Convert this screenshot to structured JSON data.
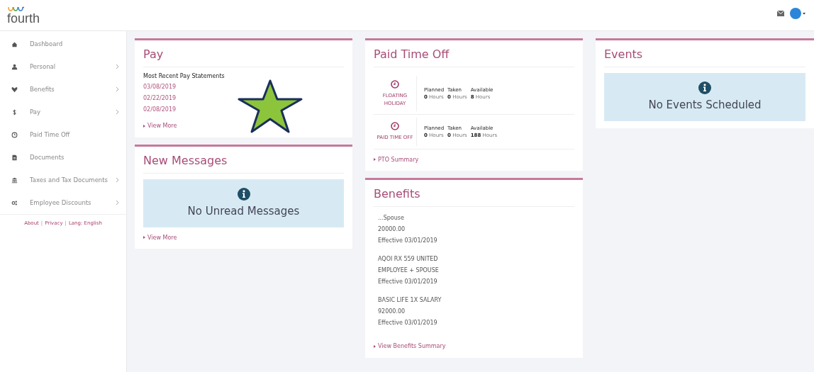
{
  "header": {
    "logo": "fourth"
  },
  "sidebar": {
    "items": [
      {
        "kind": "home",
        "label": "Dashboard",
        "submenu": false
      },
      {
        "kind": "person",
        "label": "Personal",
        "submenu": true
      },
      {
        "kind": "heart",
        "label": "Benefits",
        "submenu": true
      },
      {
        "kind": "dollar",
        "label": "Pay",
        "submenu": true
      },
      {
        "kind": "clock",
        "label": "Paid Time Off",
        "submenu": false
      },
      {
        "kind": "document",
        "label": "Documents",
        "submenu": false
      },
      {
        "kind": "bank",
        "label": "Taxes and Tax Documents",
        "submenu": true
      },
      {
        "kind": "gears",
        "label": "Employee Discounts",
        "submenu": true
      }
    ],
    "footer_links": [
      "About",
      "Privacy",
      "Lang: English"
    ],
    "separator": "|"
  },
  "pay": {
    "title": "Pay",
    "subtitle": "Most Recent Pay Statements",
    "statements": [
      "03/08/2019",
      "02/22/2019",
      "02/08/2019"
    ],
    "link": "View More"
  },
  "messages": {
    "title": "New Messages",
    "notice": "No Unread Messages",
    "link": "View More"
  },
  "paid_time_off": {
    "title": "Paid Time Off",
    "rows": [
      {
        "name": "FLOATING HOLIDAY",
        "columns": [
          {
            "header": "Planned",
            "amount": "0",
            "unit": "Hours"
          },
          {
            "header": "Taken",
            "amount": "0",
            "unit": "Hours"
          },
          {
            "header": "Available",
            "amount": "8",
            "unit": "Hours"
          }
        ]
      },
      {
        "name": "PAID TIME OFF",
        "columns": [
          {
            "header": "Planned",
            "amount": "0",
            "unit": "Hours"
          },
          {
            "header": "Taken",
            "amount": "0",
            "unit": "Hours"
          },
          {
            "header": "Available",
            "amount": "188",
            "unit": "Hours"
          }
        ]
      }
    ],
    "link": "PTO Summary"
  },
  "benefits": {
    "title": "Benefits",
    "items": [
      [
        "...Spouse",
        "20000.00",
        "Effective 03/01/2019"
      ],
      [
        "AQOI RX 559 UNITED",
        "EMPLOYEE + SPOUSE",
        "Effective 03/01/2019"
      ],
      [
        "BASIC LIFE 1X SALARY",
        "92000.00",
        "Effective 03/01/2019"
      ]
    ],
    "link": "View Benefits Summary"
  },
  "events": {
    "title": "Events",
    "notice": "No Events Scheduled"
  }
}
